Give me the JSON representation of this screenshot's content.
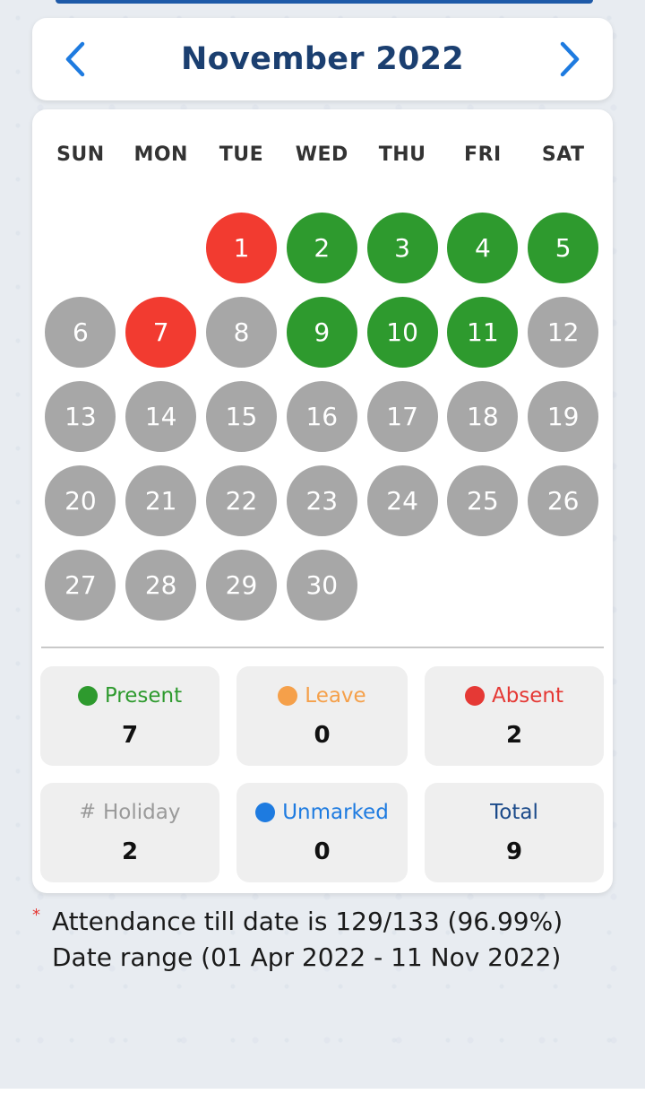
{
  "header": {
    "month_title": "November 2022",
    "prev_icon": "chevron-left-icon",
    "next_icon": "chevron-right-icon"
  },
  "weekdays": [
    "SUN",
    "MON",
    "TUE",
    "WED",
    "THU",
    "FRI",
    "SAT"
  ],
  "calendar": {
    "leading_blanks": 2,
    "days": [
      {
        "day": "1",
        "status": "absent"
      },
      {
        "day": "2",
        "status": "present"
      },
      {
        "day": "3",
        "status": "present"
      },
      {
        "day": "4",
        "status": "present"
      },
      {
        "day": "5",
        "status": "present"
      },
      {
        "day": "6",
        "status": "unmarked"
      },
      {
        "day": "7",
        "status": "absent"
      },
      {
        "day": "8",
        "status": "unmarked"
      },
      {
        "day": "9",
        "status": "present"
      },
      {
        "day": "10",
        "status": "present"
      },
      {
        "day": "11",
        "status": "present"
      },
      {
        "day": "12",
        "status": "unmarked"
      },
      {
        "day": "13",
        "status": "unmarked"
      },
      {
        "day": "14",
        "status": "unmarked"
      },
      {
        "day": "15",
        "status": "unmarked"
      },
      {
        "day": "16",
        "status": "unmarked"
      },
      {
        "day": "17",
        "status": "unmarked"
      },
      {
        "day": "18",
        "status": "unmarked"
      },
      {
        "day": "19",
        "status": "unmarked"
      },
      {
        "day": "20",
        "status": "unmarked"
      },
      {
        "day": "21",
        "status": "unmarked"
      },
      {
        "day": "22",
        "status": "unmarked"
      },
      {
        "day": "23",
        "status": "unmarked"
      },
      {
        "day": "24",
        "status": "unmarked"
      },
      {
        "day": "25",
        "status": "unmarked"
      },
      {
        "day": "26",
        "status": "unmarked"
      },
      {
        "day": "27",
        "status": "unmarked"
      },
      {
        "day": "28",
        "status": "unmarked"
      },
      {
        "day": "29",
        "status": "unmarked"
      },
      {
        "day": "30",
        "status": "unmarked"
      }
    ]
  },
  "stats": [
    {
      "key": "present",
      "label": "Present",
      "value": "7",
      "marker": "dot",
      "color": "#2e9a2e"
    },
    {
      "key": "leave",
      "label": "Leave",
      "value": "0",
      "marker": "dot",
      "color": "#f5a04a"
    },
    {
      "key": "absent",
      "label": "Absent",
      "value": "2",
      "marker": "dot",
      "color": "#e53935"
    },
    {
      "key": "holiday",
      "label": "Holiday",
      "value": "2",
      "marker": "#",
      "color": "#9a9a9a"
    },
    {
      "key": "unmarked",
      "label": "Unmarked",
      "value": "0",
      "marker": "dot",
      "color": "#1e7be0"
    },
    {
      "key": "total",
      "label": "Total",
      "value": "9",
      "marker": "none",
      "color": "#1b4a8a"
    }
  ],
  "footnote": {
    "asterisk": "*",
    "line1": "Attendance till date is 129/133 (96.99%)",
    "line2": "Date range (01 Apr 2022 - 11 Nov 2022)"
  },
  "colors": {
    "present": "#2e9a2e",
    "absent": "#f23b30",
    "unmarked": "#a7a7a7",
    "title": "#1b3f70",
    "nav": "#1e7be0"
  }
}
